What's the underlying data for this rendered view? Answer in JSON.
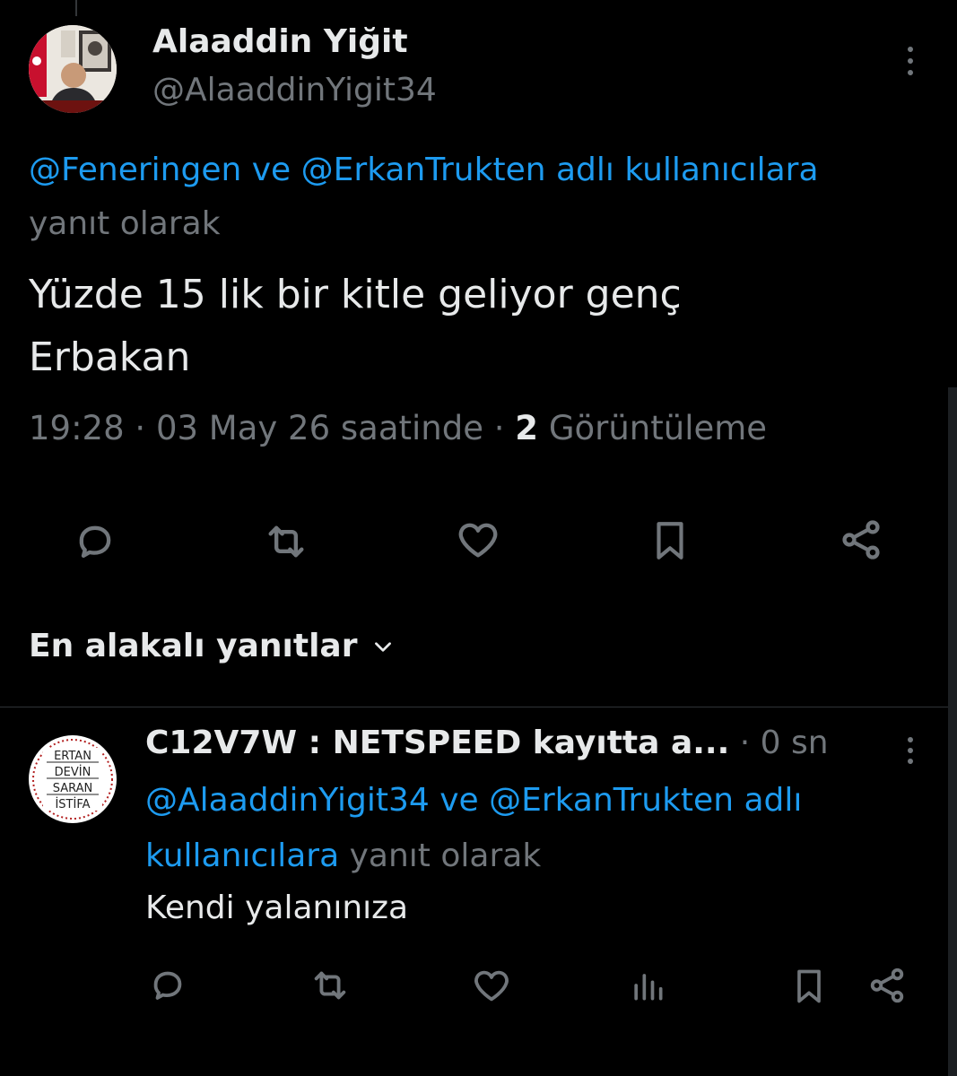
{
  "tweet": {
    "author_name": "Alaaddin Yiğit",
    "author_handle": "@AlaaddinYigit34",
    "reply_to": {
      "mention_1": "@Feneringen",
      "connector": "ve",
      "mention_2": "@ErkanTrukten",
      "target_word": "adlı kullanıcılara",
      "suffix": "yanıt olarak"
    },
    "text_line_1": "Yüzde 15 lik bir kitle geliyor genç",
    "text_line_2": "Erbakan",
    "time": "19:28",
    "date_text": "03 May 26 saatinde",
    "separator": "·",
    "views_count": "2",
    "views_label": "Görüntüleme",
    "actions": [
      "reply-icon",
      "retweet-icon",
      "like-icon",
      "bookmark-icon",
      "share-icon"
    ]
  },
  "replies_sort": {
    "label": "En alakalı yanıtlar",
    "icon": "chevron-down-icon"
  },
  "reply": {
    "author_name": "C12V7W : NETSPEED kayıtta a...",
    "separator": "·",
    "time": "0 sn",
    "avatar_text": [
      "ERTAN",
      "DEVİN",
      "SARAN",
      "İSTİFA"
    ],
    "reply_to": {
      "mention_1": "@AlaaddinYigit34",
      "connector": "ve",
      "mention_2": "@ErkanTrukten",
      "target_word_1": "adlı",
      "target_word_2": "kullanıcılara",
      "suffix": "yanıt olarak"
    },
    "text": "Kendi yalanınıza",
    "actions": [
      "reply-icon",
      "retweet-icon",
      "like-icon",
      "views-icon",
      "bookmark-icon",
      "share-icon"
    ]
  },
  "colors": {
    "background": "#000000",
    "text": "#e7e9ea",
    "muted": "#71767b",
    "link": "#1d9bf0",
    "divider": "#2f3336"
  }
}
